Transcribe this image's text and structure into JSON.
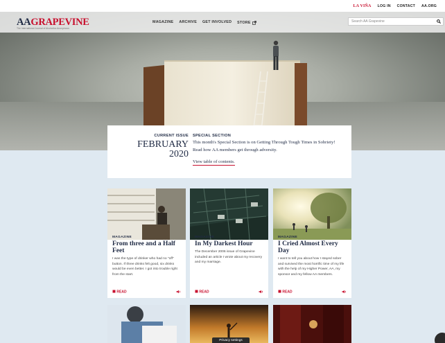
{
  "utility": {
    "lavina": "LA VIÑA",
    "login": "LOG IN",
    "contact": "CONTACT",
    "aaorg": "AA.ORG"
  },
  "brand": {
    "logo_aa": "AA",
    "logo_grapevine": "GRAPEVINE",
    "tagline": "The International Journal of Alcoholics Anonymous"
  },
  "nav": {
    "magazine": "MAGAZINE",
    "archive": "ARCHIVE",
    "get_involved": "GET INVOLVED",
    "store": "STORE"
  },
  "search": {
    "placeholder": "Search AA Grapevine"
  },
  "issue": {
    "kicker": "CURRENT ISSUE",
    "month": "FEBRUARY",
    "year": "2020",
    "special_kicker": "SPECIAL SECTION",
    "special_text": "This month's Special Section is on Getting Through Tough Times in Sobriety! Read how AA members get through adversity.",
    "toc_link": "View table of contents."
  },
  "cards": [
    {
      "kicker": "MAGAZINE",
      "title": "From three and a Half Feet",
      "desc": "I was the type of drinker who had no \"off\" button. If three drinks felt good, six drinks would be even better. I got into trouble right from the start.",
      "read": "READ"
    },
    {
      "kicker": "MAGAZINE",
      "title": "In My Darkest Hour",
      "desc": "The December 2006 issue of Grapevine included an article I wrote about my recovery and my marriage.",
      "read": "READ"
    },
    {
      "kicker": "MAGAZINE",
      "title": "I Cried Almost Every Day",
      "desc": "I want to tell you about how I stayed sober and survived the most horrific time of my life with the help of my Higher Power, AA, my sponsor and my fellow AA members.",
      "read": "READ"
    }
  ],
  "privacy": {
    "label": "Privacy settings"
  },
  "colors": {
    "brand_red": "#c8102e",
    "navy": "#1f2a44",
    "page_bg": "#dfe9f1"
  }
}
